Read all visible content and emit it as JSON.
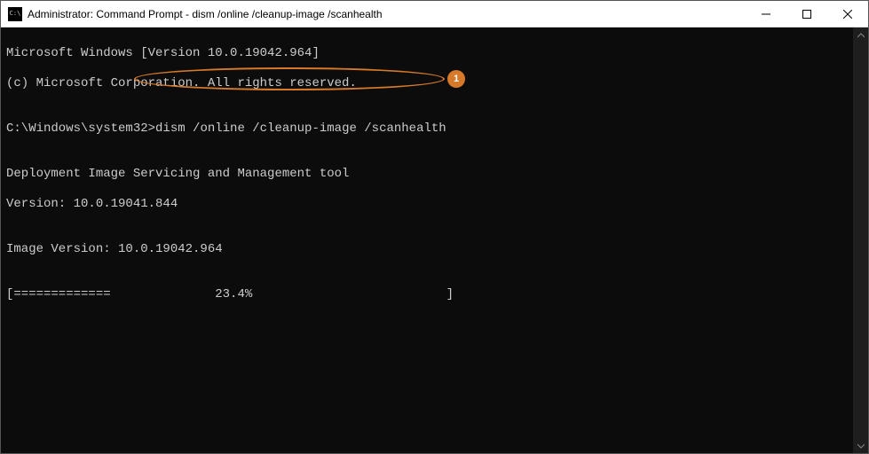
{
  "titlebar": {
    "title": "Administrator: Command Prompt - dism  /online /cleanup-image /scanhealth"
  },
  "terminal": {
    "line1": "Microsoft Windows [Version 10.0.19042.964]",
    "line2": "(c) Microsoft Corporation. All rights reserved.",
    "blank1": "",
    "prompt_prefix": "C:\\Windows\\system32>",
    "prompt_command": "dism /online /cleanup-image /scanhealth",
    "blank2": "",
    "line5": "Deployment Image Servicing and Management tool",
    "line6": "Version: 10.0.19041.844",
    "blank3": "",
    "line8": "Image Version: 10.0.19042.964",
    "blank4": "",
    "progress": "[=============              23.4%                          ]"
  },
  "annotation": {
    "badge": "1"
  }
}
